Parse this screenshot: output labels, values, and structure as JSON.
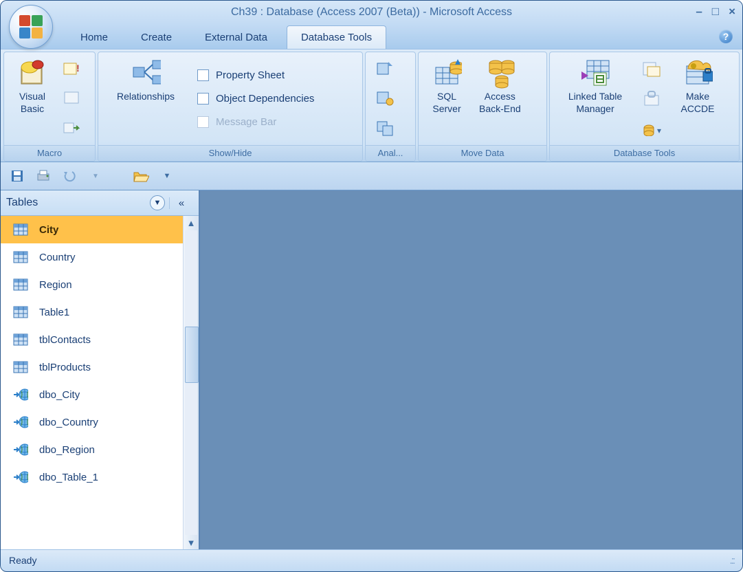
{
  "title": "Ch39 : Database (Access 2007 (Beta)) - Microsoft Access",
  "tabs": [
    "Home",
    "Create",
    "External Data",
    "Database Tools"
  ],
  "activeTab": 3,
  "ribbonGroups": {
    "macro": {
      "label": "Macro",
      "visualBasic": "Visual\nBasic"
    },
    "showHide": {
      "label": "Show/Hide",
      "relationships": "Relationships",
      "propertySheet": "Property Sheet",
      "objectDeps": "Object Dependencies",
      "messageBar": "Message Bar"
    },
    "analyze": {
      "label": "Anal..."
    },
    "moveData": {
      "label": "Move Data",
      "sqlServer": "SQL\nServer",
      "accessBE": "Access\nBack-End"
    },
    "dbTools": {
      "label": "Database Tools",
      "linkedTable": "Linked Table\nManager",
      "makeAccde": "Make\nACCDE"
    }
  },
  "navPane": {
    "title": "Tables",
    "items": [
      {
        "label": "City",
        "type": "table",
        "selected": true
      },
      {
        "label": "Country",
        "type": "table"
      },
      {
        "label": "Region",
        "type": "table"
      },
      {
        "label": "Table1",
        "type": "table"
      },
      {
        "label": "tblContacts",
        "type": "table"
      },
      {
        "label": "tblProducts",
        "type": "table"
      },
      {
        "label": "dbo_City",
        "type": "linked"
      },
      {
        "label": "dbo_Country",
        "type": "linked"
      },
      {
        "label": "dbo_Region",
        "type": "linked"
      },
      {
        "label": "dbo_Table_1",
        "type": "linked"
      }
    ]
  },
  "status": "Ready"
}
